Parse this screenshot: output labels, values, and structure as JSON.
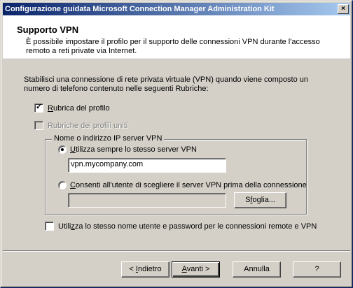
{
  "window": {
    "title": "Configurazione guidata Microsoft Connection Manager Administration Kit",
    "close_glyph": "×"
  },
  "header": {
    "title": "Supporto VPN",
    "description": "È possibile impostare il profilo per il supporto delle connessioni VPN durante l'accesso remoto a reti private via Internet."
  },
  "intro": "Stabilisci una connessione di rete privata virtuale (VPN) quando viene composto un numero di telefono contenuto nelle seguenti Rubriche:",
  "options": {
    "profile_phonebook": {
      "label_mn": "R",
      "label_rest": "ubrica del profilo",
      "checked": true
    },
    "merged_phonebooks": {
      "label": "Rubriche dei profili uniti",
      "checked": false,
      "disabled": true
    }
  },
  "vpn_group": {
    "legend": "Nome o indirizzo IP server VPN",
    "radio_same": {
      "label_mn": "U",
      "label_rest": "tilizza sempre lo stesso server VPN",
      "selected": true
    },
    "server_value": "vpn.mycompany.com",
    "radio_user": {
      "label_mn": "C",
      "label_rest": "onsenti all'utente di scegliere il server VPN prima della connessione",
      "selected": false
    },
    "file_value": "",
    "browse_mn": "f",
    "browse_pre": "S",
    "browse_rest": "oglia..."
  },
  "same_credentials": {
    "label_pre": "Utili",
    "label_mn": "z",
    "label_rest": "za lo stesso nome utente e password per le connessioni remote e VPN",
    "checked": false
  },
  "buttons": {
    "back_pre": "< ",
    "back_mn": "I",
    "back_rest": "ndietro",
    "next_mn": "A",
    "next_rest": "vanti >",
    "cancel": "Annulla",
    "help": "?"
  }
}
